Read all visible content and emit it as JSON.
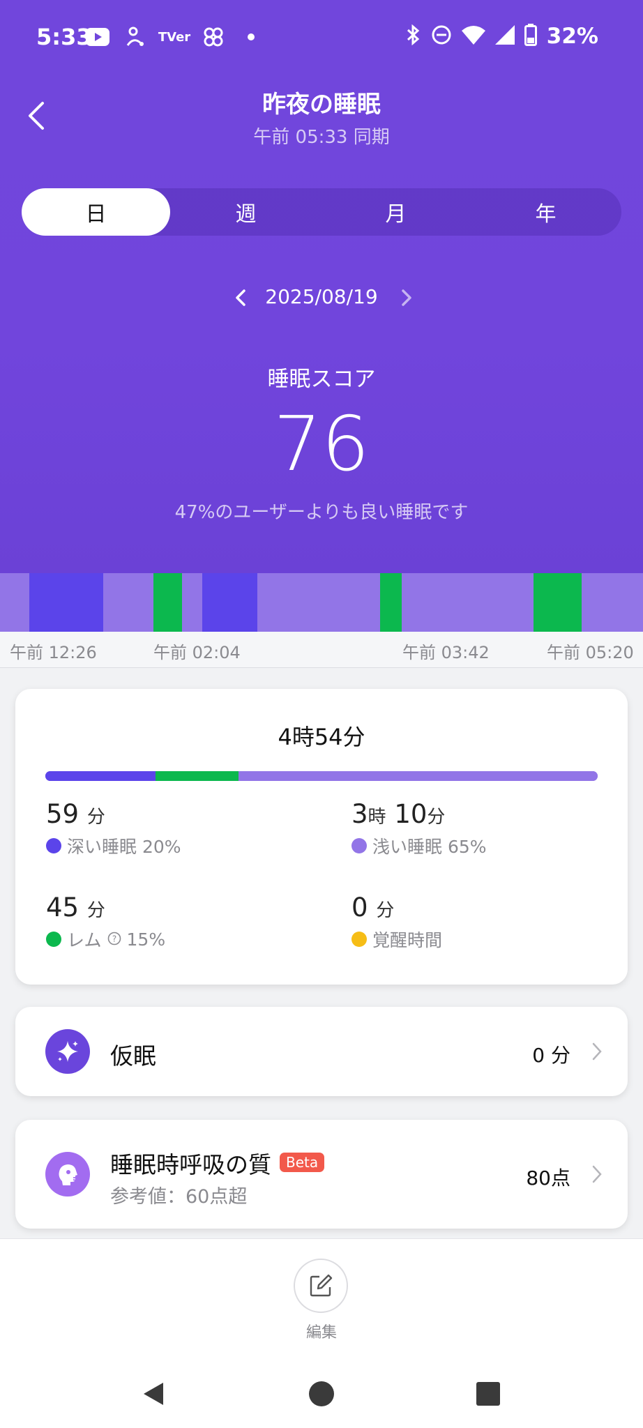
{
  "status_bar": {
    "time": "5:33",
    "left_icons": [
      "youtube-icon",
      "app-notification-icon",
      "tver-icon",
      "pinwheel-icon",
      "more-dot-icon"
    ],
    "tver_text": "TVer",
    "battery_pct": "32%",
    "right_icons": [
      "bluetooth-icon",
      "do-not-disturb-icon",
      "wifi-icon",
      "signal-icon",
      "battery-icon"
    ]
  },
  "header": {
    "title": "昨夜の睡眠",
    "subtitle": "午前 05:33 同期"
  },
  "tabs": [
    {
      "label": "日",
      "active": true
    },
    {
      "label": "週",
      "active": false
    },
    {
      "label": "月",
      "active": false
    },
    {
      "label": "年",
      "active": false
    }
  ],
  "date": {
    "label": "2025/08/19"
  },
  "score": {
    "label": "睡眠スコア",
    "value": "76",
    "description": "47%のユーザーよりも良い睡眠です"
  },
  "hypnogram": {
    "start_label": "午前 12:26",
    "ticks": [
      "午前 12:26",
      "午前 02:04",
      "午前 03:42",
      "午前 05:20"
    ],
    "colors": {
      "deep": "#5b44ea",
      "light": "#9275e7",
      "rem": "#0cb84e",
      "awake": "#f6bd16"
    },
    "segments": [
      {
        "stage": "light",
        "start": 0.0,
        "end": 0.046
      },
      {
        "stage": "deep",
        "start": 0.046,
        "end": 0.161
      },
      {
        "stage": "light",
        "start": 0.161,
        "end": 0.239
      },
      {
        "stage": "rem",
        "start": 0.239,
        "end": 0.283
      },
      {
        "stage": "light",
        "start": 0.283,
        "end": 0.315
      },
      {
        "stage": "deep",
        "start": 0.315,
        "end": 0.4
      },
      {
        "stage": "light",
        "start": 0.4,
        "end": 0.591
      },
      {
        "stage": "rem",
        "start": 0.591,
        "end": 0.625
      },
      {
        "stage": "light",
        "start": 0.625,
        "end": 0.83
      },
      {
        "stage": "rem",
        "start": 0.83,
        "end": 0.905
      },
      {
        "stage": "light",
        "start": 0.905,
        "end": 1.0
      }
    ]
  },
  "summary": {
    "total": "4時54分",
    "bar": [
      {
        "stage": "deep",
        "fraction": 0.2
      },
      {
        "stage": "rem",
        "fraction": 0.15
      },
      {
        "stage": "light",
        "fraction": 0.65
      }
    ],
    "deep": {
      "value": "59",
      "unit": "分",
      "label": "深い睡眠 20%"
    },
    "light": {
      "hours": "3",
      "hours_unit": "時",
      "minutes": "10",
      "minutes_unit": "分",
      "label": "浅い睡眠 65%"
    },
    "rem": {
      "value": "45",
      "unit": "分",
      "label_name": "レム",
      "label_pct": "15%",
      "help_icon": "question-circle-icon"
    },
    "awake": {
      "value": "0",
      "unit": "分",
      "label": "覚醒時間"
    }
  },
  "nap": {
    "icon": "sparkle-icon",
    "title": "仮眠",
    "value": "0 分"
  },
  "breathing": {
    "icon": "breathing-face-icon",
    "title": "睡眠時呼吸の質",
    "badge": "Beta",
    "subtitle": "参考値：60点超",
    "value": "80点"
  },
  "edit": {
    "label": "編集",
    "icon": "edit-icon"
  },
  "nav_bar": [
    "back-triangle-icon",
    "home-circle-icon",
    "recents-square-icon"
  ]
}
